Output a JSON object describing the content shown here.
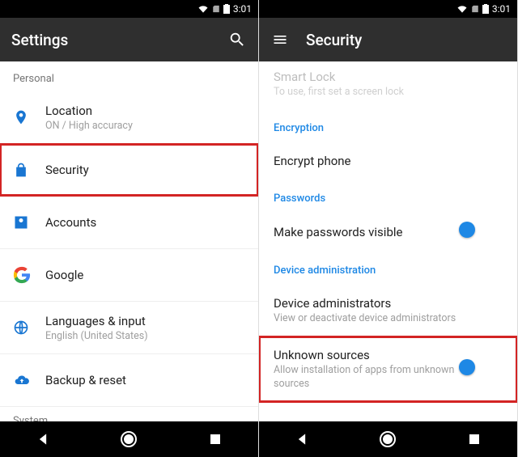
{
  "status": {
    "time": "3:01"
  },
  "left": {
    "title": "Settings",
    "section_personal": "Personal",
    "section_system": "System",
    "items": {
      "location": {
        "label": "Location",
        "sub": "ON / High accuracy"
      },
      "security": {
        "label": "Security"
      },
      "accounts": {
        "label": "Accounts"
      },
      "google": {
        "label": "Google"
      },
      "languages": {
        "label": "Languages & input",
        "sub": "English (United States)"
      },
      "backup": {
        "label": "Backup & reset"
      }
    }
  },
  "right": {
    "title": "Security",
    "smartlock": {
      "label": "Smart Lock",
      "sub": "To use, first set a screen lock"
    },
    "sections": {
      "encryption": "Encryption",
      "passwords": "Passwords",
      "device_admin": "Device administration"
    },
    "items": {
      "encrypt": {
        "label": "Encrypt phone"
      },
      "pwvis": {
        "label": "Make passwords visible"
      },
      "devadmin": {
        "label": "Device administrators",
        "sub": "View or deactivate device administrators"
      },
      "unknown": {
        "label": "Unknown sources",
        "sub": "Allow installation of apps from unknown sources"
      }
    }
  }
}
